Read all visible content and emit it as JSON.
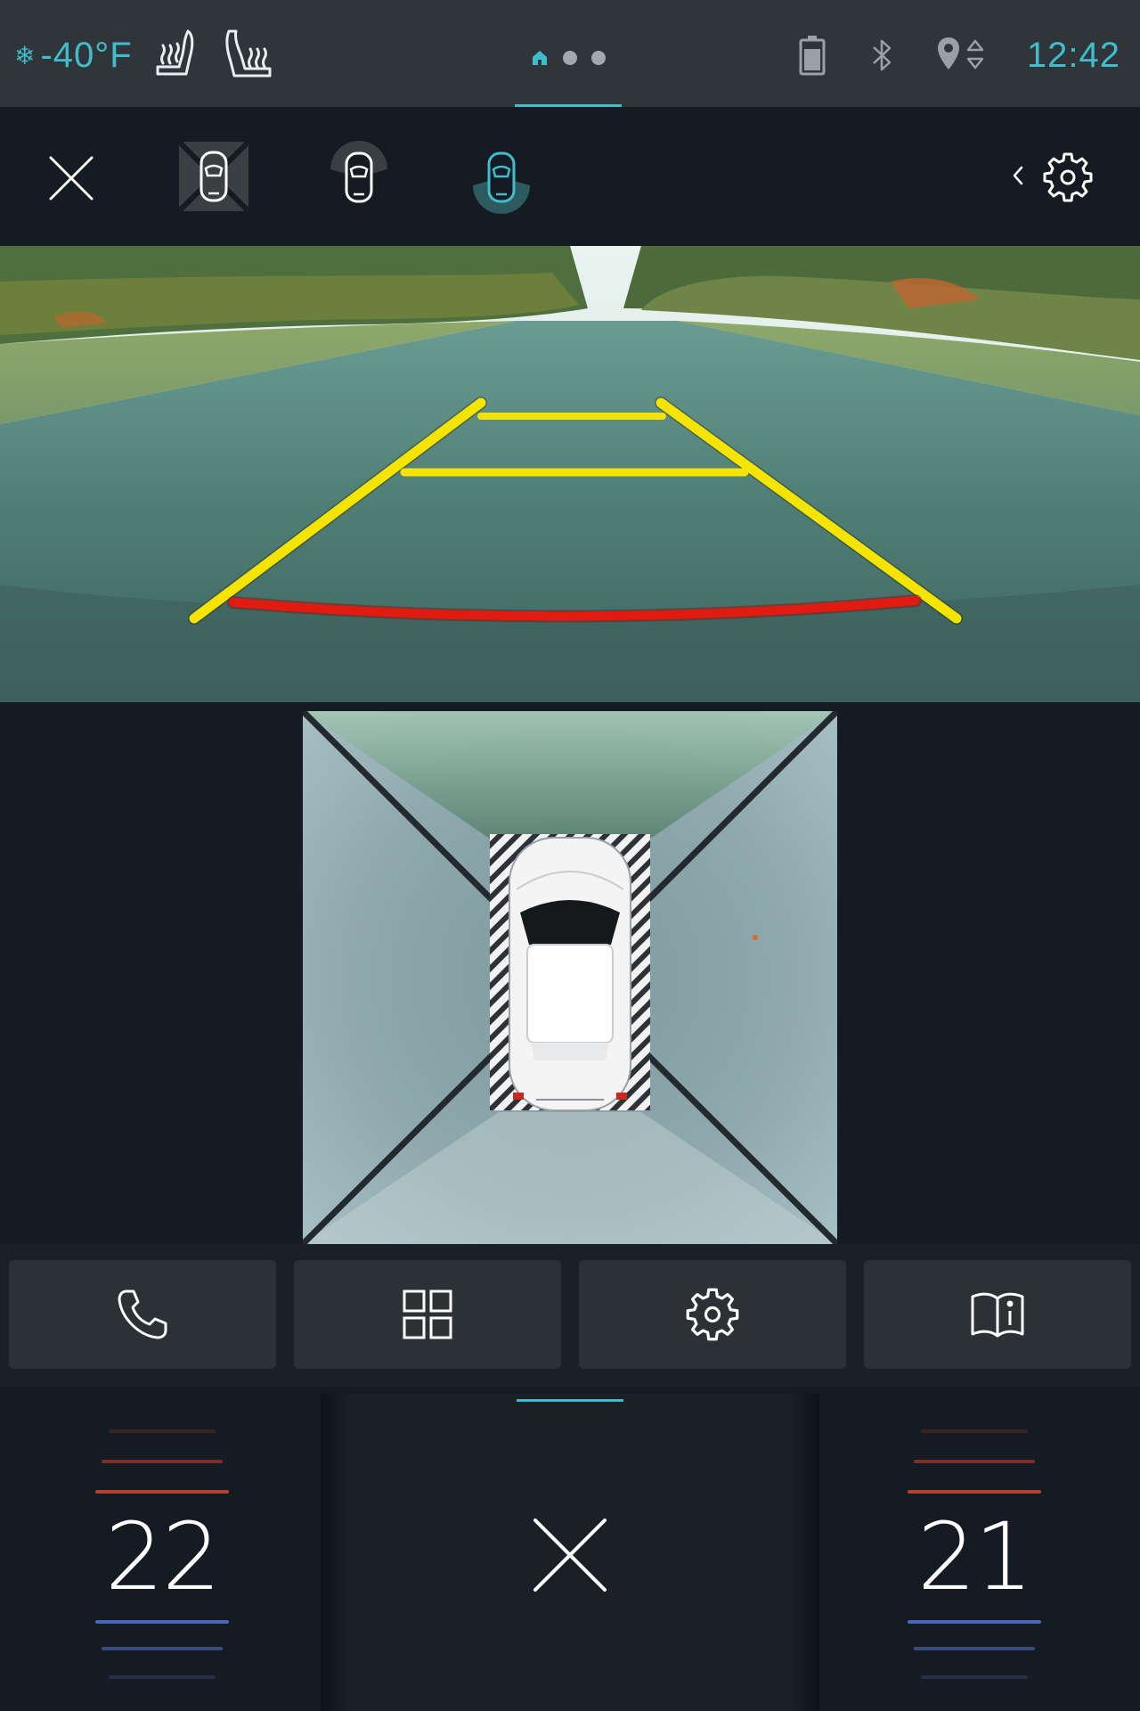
{
  "status_bar": {
    "outside_temp": "-40°F",
    "clock": "12:42",
    "icons": [
      "snowflake-icon",
      "heated-seat-icon",
      "heated-seat-rear-icon",
      "home-icon",
      "battery-icon",
      "bluetooth-icon",
      "gps-icon"
    ],
    "page_count": 3,
    "active_page": 1
  },
  "camera_toolbar": {
    "icons": [
      "close-icon",
      "camera-view-top-icon",
      "camera-view-front-icon",
      "camera-view-rear-icon",
      "chevron-left-icon",
      "settings-icon"
    ],
    "active_view": "camera-view-rear-icon"
  },
  "shortcuts": {
    "items": [
      "phone-icon",
      "apps-grid-icon",
      "settings-icon",
      "manual-icon"
    ]
  },
  "climate": {
    "left_temp": "22",
    "right_temp": "21",
    "center_icon": "close-icon"
  },
  "colors": {
    "accent": "#3fbdcc",
    "guide_yellow": "#f4e400",
    "guide_red": "#e11a12",
    "heat_line": "#b2422e",
    "cool_line": "#4b67b8"
  }
}
